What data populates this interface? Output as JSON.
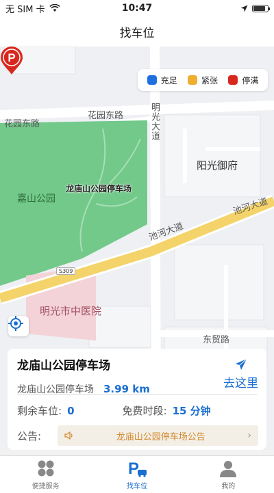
{
  "status_bar": {
    "carrier": "无 SIM 卡",
    "time": "10:47",
    "battery_level": 0.85
  },
  "navbar": {
    "title": "找车位"
  },
  "legend": [
    {
      "label": "充足",
      "color": "#1e6fe0"
    },
    {
      "label": "紧张",
      "color": "#f0ae2e"
    },
    {
      "label": "停满",
      "color": "#d8281e"
    }
  ],
  "map": {
    "labels": {
      "huayuan_east_1": "花园东路",
      "huayuan_east_2": "花园东路",
      "mingguang_avenue": "明光大道",
      "yangguang_yufu": "阳光御府",
      "jiashan_park": "嘉山公园",
      "chihe_avenue_1": "池河大道",
      "chihe_avenue_2": "池河大道",
      "hospital": "明光市中医院",
      "dongmao_road": "东贸路",
      "route_shield": "S309"
    },
    "marker_label": "龙庙山公园停车场",
    "marker_color": "#d8281e",
    "park_color": "#72c98a"
  },
  "card": {
    "title": "龙庙山公园停车场",
    "subtitle": "龙庙山公园停车场",
    "distance": "3.99 km",
    "go_label": "去这里",
    "remaining_label": "剩余车位:",
    "remaining_value": "0",
    "free_label": "免费时段:",
    "free_value": "15 分钟",
    "notice_label": "公告:",
    "notice_text": "龙庙山公园停车场公告",
    "accent_color": "#1a6fd1"
  },
  "tabbar": {
    "items": [
      {
        "label": "便捷服务",
        "icon": "grid-icon",
        "active": false
      },
      {
        "label": "找车位",
        "icon": "parking-icon",
        "active": true
      },
      {
        "label": "我的",
        "icon": "user-icon",
        "active": false
      }
    ]
  }
}
